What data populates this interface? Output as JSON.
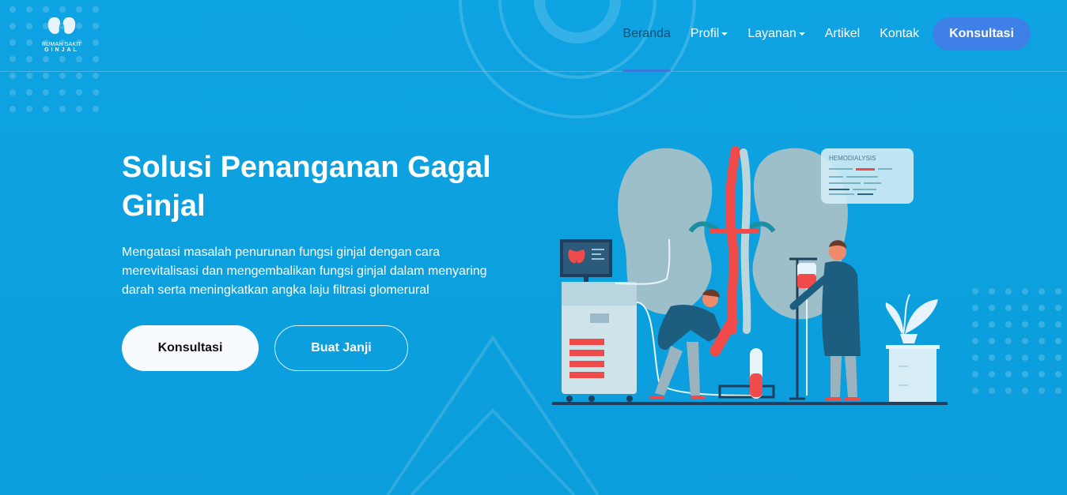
{
  "logo": {
    "line1": "RUMAH SAKIT",
    "line2": "GINJAL"
  },
  "nav": {
    "items": [
      {
        "label": "Beranda",
        "active": true,
        "dropdown": false
      },
      {
        "label": "Profil",
        "active": false,
        "dropdown": true
      },
      {
        "label": "Layanan",
        "active": false,
        "dropdown": true
      },
      {
        "label": "Artikel",
        "active": false,
        "dropdown": false
      },
      {
        "label": "Kontak",
        "active": false,
        "dropdown": false
      }
    ],
    "cta_label": "Konsultasi"
  },
  "hero": {
    "title": "Solusi Penanganan Gagal Ginjal",
    "description": "Mengatasi masalah penurunan fungsi ginjal dengan cara merevitalisasi dan mengembalikan fungsi ginjal dalam menyaring darah serta meningkatkan angka laju filtrasi glomerural",
    "primary_button": "Konsultasi",
    "secondary_button": "Buat Janji"
  },
  "illustration": {
    "card_label": "HEMODIALYSIS"
  },
  "colors": {
    "background": "#0ea3e2",
    "nav_active": "#0a4f74",
    "accent_button": "#3f7fe8",
    "blood_red": "#ef4b4b"
  }
}
